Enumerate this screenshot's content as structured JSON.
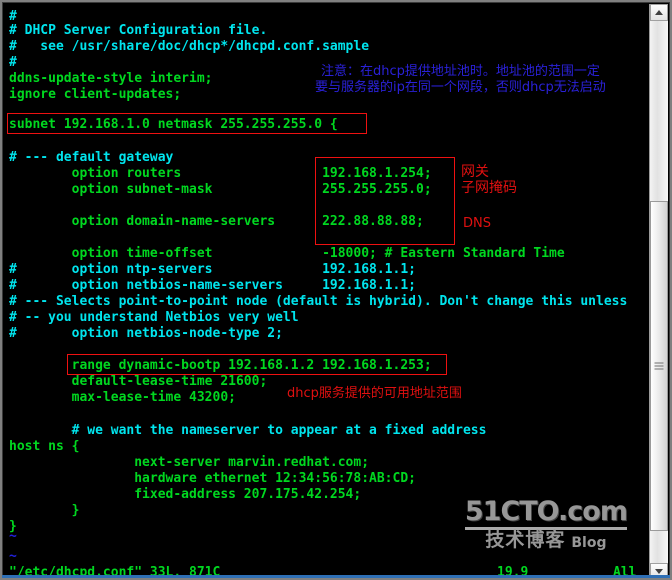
{
  "window": {
    "title": "vim - /etc/dhcpd.conf",
    "bg_color": "#000000",
    "frame_color": "#808080"
  },
  "editor": {
    "file_status": "\"/etc/dhcpd.conf\" 33L, 871C",
    "cursor_position": "19,9",
    "scroll_position": "All",
    "colors": {
      "comment": "#00e5ee",
      "code": "#00d820",
      "tilde": "#2222dd",
      "annotation_red": "#e01010",
      "annotation_blue": "#2a21d8"
    },
    "lines": [
      {
        "text": "#",
        "color": "comment"
      },
      {
        "text": "# DHCP Server Configuration file.",
        "color": "comment"
      },
      {
        "text": "#   see /usr/share/doc/dhcp*/dhcpd.conf.sample",
        "color": "comment"
      },
      {
        "text": "#",
        "color": "comment"
      },
      {
        "text": "ddns-update-style interim;",
        "color": "code"
      },
      {
        "text": "ignore client-updates;",
        "color": "code"
      },
      {
        "text": "",
        "color": "code"
      },
      {
        "text": "subnet 192.168.1.0 netmask 255.255.255.0 {",
        "color": "code"
      },
      {
        "text": "",
        "color": "code"
      },
      {
        "text": "# --- default gateway",
        "color": "comment"
      },
      {
        "text": "        option routers                  192.168.1.254;",
        "color": "code"
      },
      {
        "text": "        option subnet-mask              255.255.255.0;",
        "color": "code"
      },
      {
        "text": "",
        "color": "code"
      },
      {
        "text": "        option domain-name-servers      222.88.88.88;",
        "color": "code"
      },
      {
        "text": "",
        "color": "code"
      },
      {
        "text": "        option time-offset              -18000; # Eastern Standard Time",
        "color": "code",
        "comment_at": 40
      },
      {
        "text": "#       option ntp-servers              192.168.1.1;",
        "color": "comment"
      },
      {
        "text": "#       option netbios-name-servers     192.168.1.1;",
        "color": "comment"
      },
      {
        "text": "# --- Selects point-to-point node (default is hybrid). Don't change this unless",
        "color": "comment"
      },
      {
        "text": "# -- you understand Netbios very well",
        "color": "comment"
      },
      {
        "text": "#       option netbios-node-type 2;",
        "color": "comment"
      },
      {
        "text": "",
        "color": "code"
      },
      {
        "text": "        range dynamic-bootp 192.168.1.2 192.168.1.253;",
        "color": "code"
      },
      {
        "text": "        default-lease-time 21600;",
        "color": "code"
      },
      {
        "text": "        max-lease-time 43200;",
        "color": "code"
      },
      {
        "text": "",
        "color": "code"
      },
      {
        "text": "        # we want the nameserver to appear at a fixed address",
        "color": "comment"
      },
      {
        "text": "host ns {",
        "color": "code"
      },
      {
        "text": "                next-server marvin.redhat.com;",
        "color": "code"
      },
      {
        "text": "                hardware ethernet 12:34:56:78:AB:CD;",
        "color": "code"
      },
      {
        "text": "                fixed-address 207.175.42.254;",
        "color": "code"
      },
      {
        "text": "        }",
        "color": "code"
      },
      {
        "text": "}",
        "color": "code"
      },
      {
        "text": "~",
        "color": "tilde"
      },
      {
        "text": "",
        "color": "code"
      },
      {
        "text": "~",
        "color": "tilde"
      }
    ]
  },
  "annotations": {
    "note_dhcp_pool_line1": "注意：在dhcp提供地址池时。地址池的范围一定",
    "note_dhcp_pool_line2": "要与服务器的ip在同一个网段，否则dhcp无法启动",
    "label_gateway": "网关",
    "label_subnet_mask": "子网掩码",
    "label_dns": "DNS",
    "label_address_range": "dhcp服务提供的可用地址范围"
  },
  "watermark": {
    "main": "51CTO.com",
    "sub": "技术博客",
    "blog": "Blog"
  },
  "scrollbar": {
    "up_arrow": "scroll-up",
    "down_arrow": "scroll-down"
  }
}
